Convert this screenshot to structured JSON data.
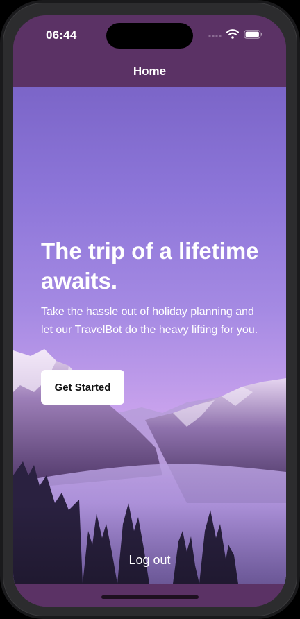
{
  "status_bar": {
    "time": "06:44",
    "icons": [
      "cellular-signal-icon",
      "wifi-icon",
      "battery-icon"
    ]
  },
  "nav": {
    "title": "Home"
  },
  "hero": {
    "headline": "The trip of a lifetime awaits.",
    "subtext": "Take the hassle out of holiday planning and let our TravelBot do the heavy lifting for you.",
    "cta_label": "Get Started",
    "background_image": "mountain-valley-photo"
  },
  "footer": {
    "logout_label": "Log out"
  },
  "colors": {
    "bar_background": "#5b3265",
    "hero_gradient_top": "#7b65c8",
    "hero_gradient_mid": "#c7a1ec",
    "button_background": "#ffffff",
    "text": "#ffffff"
  }
}
